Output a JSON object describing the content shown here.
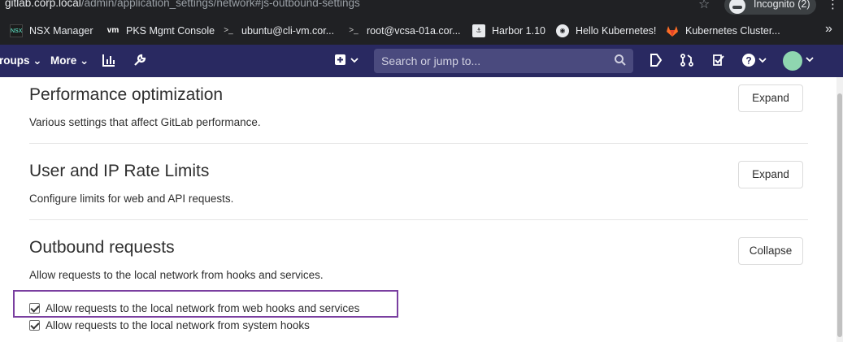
{
  "browser": {
    "url_host": "gitlab.corp.local",
    "url_path": "/admin/application_settings/network#js-outbound-settings",
    "incognito_label": "Incognito (2)"
  },
  "bookmarks": [
    {
      "label": "NSX  Manager",
      "icon": "nsx-icon"
    },
    {
      "label": "PKS Mgmt Console",
      "icon": "vm-icon"
    },
    {
      "label": "ubuntu@cli-vm.cor...",
      "icon": "terminal-icon"
    },
    {
      "label": "root@vcsa-01a.cor...",
      "icon": "terminal-icon"
    },
    {
      "label": "Harbor 1.10",
      "icon": "harbor-icon"
    },
    {
      "label": "Hello Kubernetes!",
      "icon": "globe-icon"
    },
    {
      "label": "Kubernetes Cluster...",
      "icon": "gitlab-icon"
    }
  ],
  "navbar": {
    "groups_label": "roups",
    "more_label": "More",
    "search_placeholder": "Search or jump to..."
  },
  "sections": [
    {
      "title": "Performance optimization",
      "description": "Various settings that affect GitLab performance.",
      "button": "Expand"
    },
    {
      "title": "User and IP Rate Limits",
      "description": "Configure limits for web and API requests.",
      "button": "Expand"
    },
    {
      "title": "Outbound requests",
      "description": "Allow requests to the local network from hooks and services.",
      "button": "Collapse"
    }
  ],
  "outbound_options": [
    {
      "label": "Allow requests to the local network from web hooks and services",
      "checked": true
    },
    {
      "label": "Allow requests to the local network from system hooks",
      "checked": true
    }
  ],
  "colors": {
    "navbar_bg": "#292961",
    "highlight_border": "#7a3fa0"
  }
}
